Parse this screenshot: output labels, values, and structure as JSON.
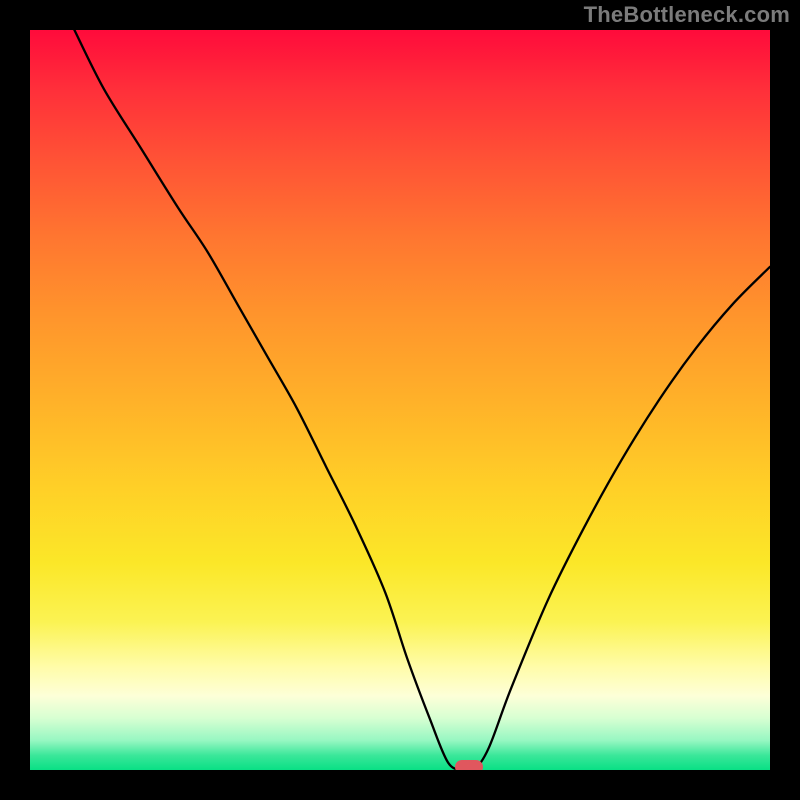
{
  "watermark": "TheBottleneck.com",
  "chart_data": {
    "type": "line",
    "title": "",
    "xlabel": "",
    "ylabel": "",
    "x_range": [
      0,
      100
    ],
    "y_range": [
      0,
      100
    ],
    "grid": false,
    "legend": false,
    "annotations": [],
    "series": [
      {
        "name": "bottleneck-curve",
        "x": [
          6,
          10,
          15,
          20,
          24,
          28,
          32,
          36,
          40,
          44,
          48,
          51,
          54,
          56.5,
          58.6,
          60,
          62,
          65,
          70,
          75,
          80,
          85,
          90,
          95,
          100
        ],
        "y": [
          100,
          92,
          84,
          76,
          70,
          63,
          56,
          49,
          41,
          33,
          24,
          15,
          7,
          1,
          0,
          0,
          3,
          11,
          23,
          33,
          42,
          50,
          57,
          63,
          68
        ]
      }
    ],
    "marker": {
      "x": 59.3,
      "y": 0,
      "color": "#e0575e"
    },
    "background_gradient": {
      "top": "#ff0b3b",
      "bottom": "#09e085"
    }
  }
}
